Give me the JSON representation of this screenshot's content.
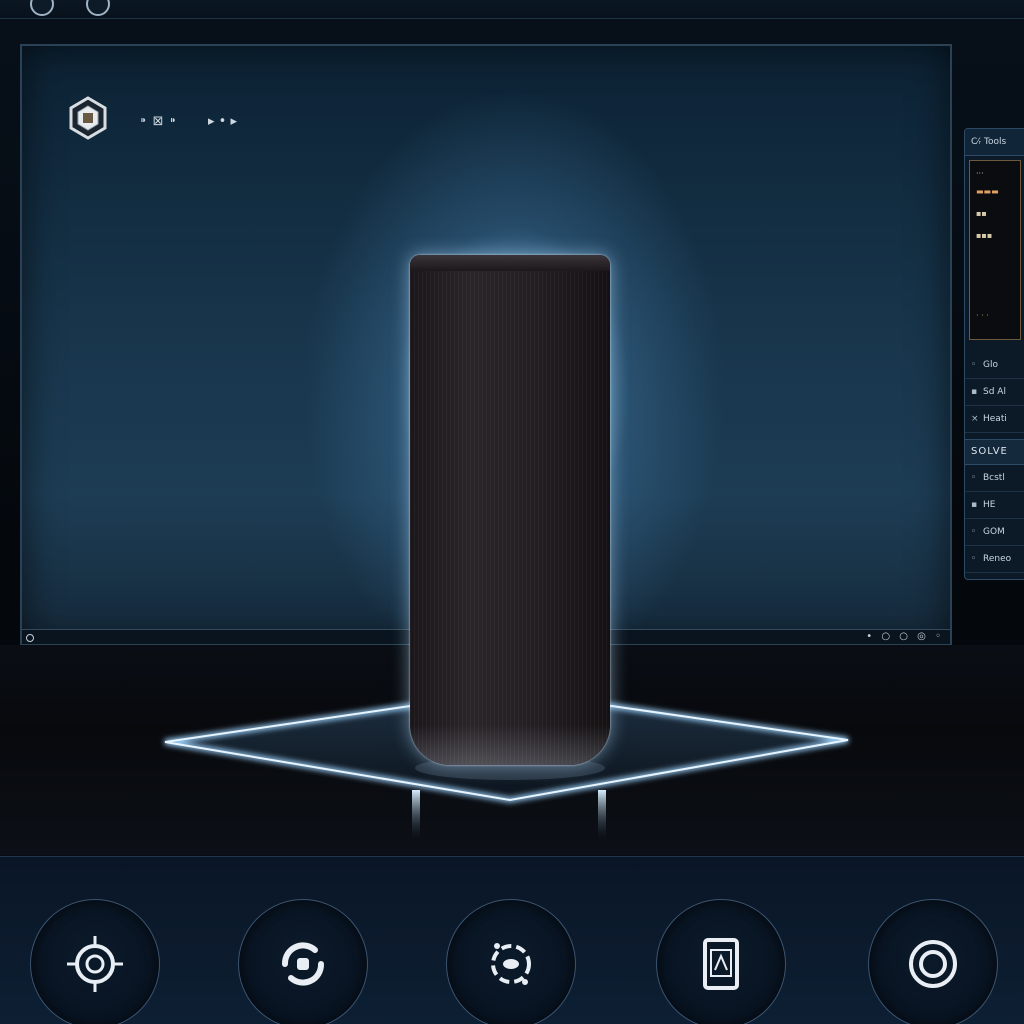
{
  "viewport": {
    "logo_icon": "hexagon-logo-icon",
    "label": "⁍ ⊠ ⁍",
    "sub_label": "▸ • ▸",
    "bottom_controls": "• ○ ○ ◎ ◦"
  },
  "side_panel": {
    "header": "C⁄ᵣ Tools",
    "preview_lines": [
      "···",
      "▬▬▬",
      "▪▪",
      "▪▪▪",
      "· · ·"
    ],
    "rows": [
      "Glo",
      "Sd Al",
      "Heati"
    ],
    "section": "SOLVE",
    "rows2": [
      "Bcstl",
      "HE",
      "GOM",
      "Reneo"
    ]
  },
  "toolbar": {
    "buttons": [
      {
        "icon": "crosshair-target-icon"
      },
      {
        "icon": "rotate-icon"
      },
      {
        "icon": "orbit-icon"
      },
      {
        "icon": "device-frame-icon"
      },
      {
        "icon": "record-circle-icon"
      }
    ]
  },
  "colors": {
    "accent": "#8fd0ff",
    "panel_border": "#2d4a66",
    "toolbar_bg": "#0a1626"
  }
}
